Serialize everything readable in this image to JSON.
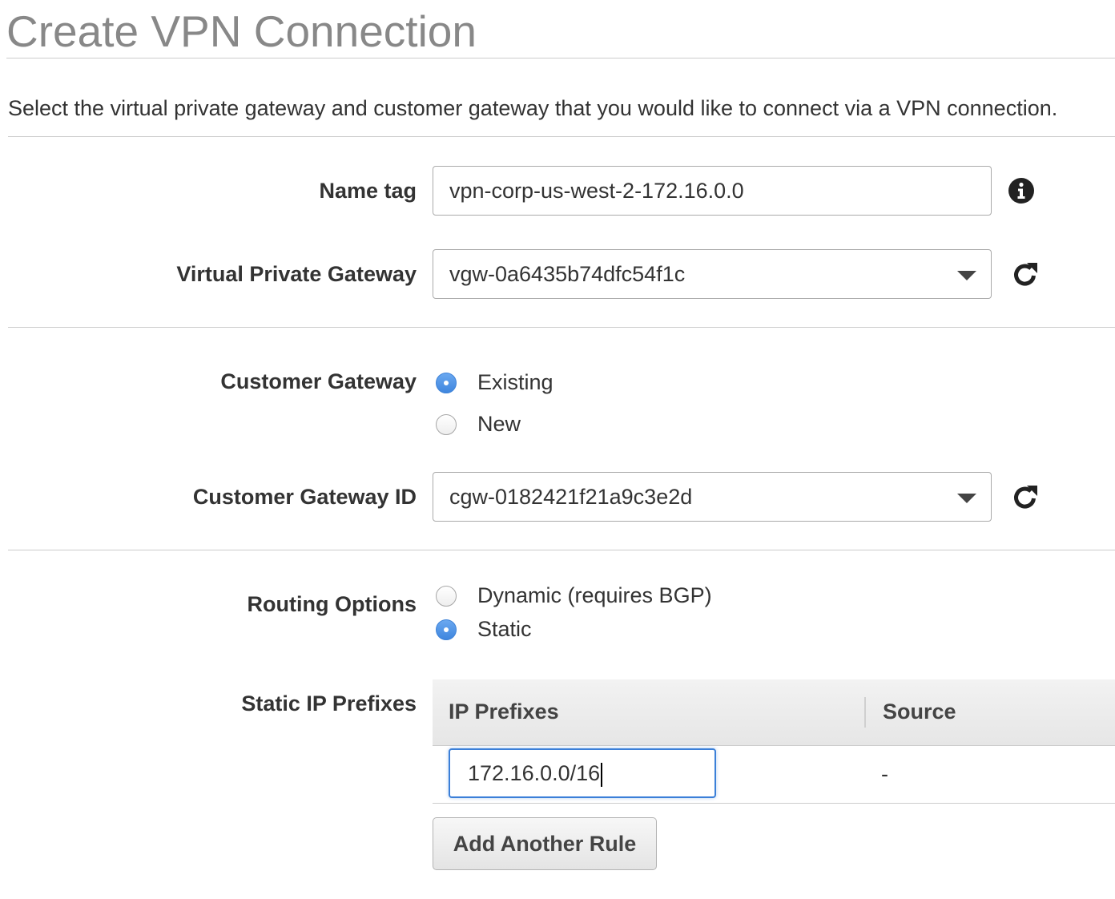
{
  "page": {
    "title": "Create VPN Connection",
    "description": "Select the virtual private gateway and customer gateway that you would like to connect via a VPN connection."
  },
  "name_tag": {
    "label": "Name tag",
    "value": "vpn-corp-us-west-2-172.16.0.0",
    "icon": "info-icon"
  },
  "virtual_private_gateway": {
    "label": "Virtual Private Gateway",
    "selected": "vgw-0a6435b74dfc54f1c",
    "icon": "refresh-icon"
  },
  "customer_gateway": {
    "label": "Customer Gateway",
    "options": [
      {
        "label": "Existing",
        "checked": true
      },
      {
        "label": "New",
        "checked": false
      }
    ]
  },
  "customer_gateway_id": {
    "label": "Customer Gateway ID",
    "selected": "cgw-0182421f21a9c3e2d",
    "icon": "refresh-icon"
  },
  "routing_options": {
    "label": "Routing Options",
    "options": [
      {
        "label": "Dynamic (requires BGP)",
        "checked": false
      },
      {
        "label": "Static",
        "checked": true
      }
    ]
  },
  "static_ip_prefixes": {
    "label": "Static IP Prefixes",
    "columns": [
      "IP Prefixes",
      "Source"
    ],
    "rows": [
      {
        "ip_prefix": "172.16.0.0/16",
        "source": "-"
      }
    ],
    "add_button_label": "Add Another Rule"
  },
  "colors": {
    "accent": "#3f86de",
    "title_gray": "#888888",
    "text": "#333333",
    "divider": "#cccccc"
  }
}
